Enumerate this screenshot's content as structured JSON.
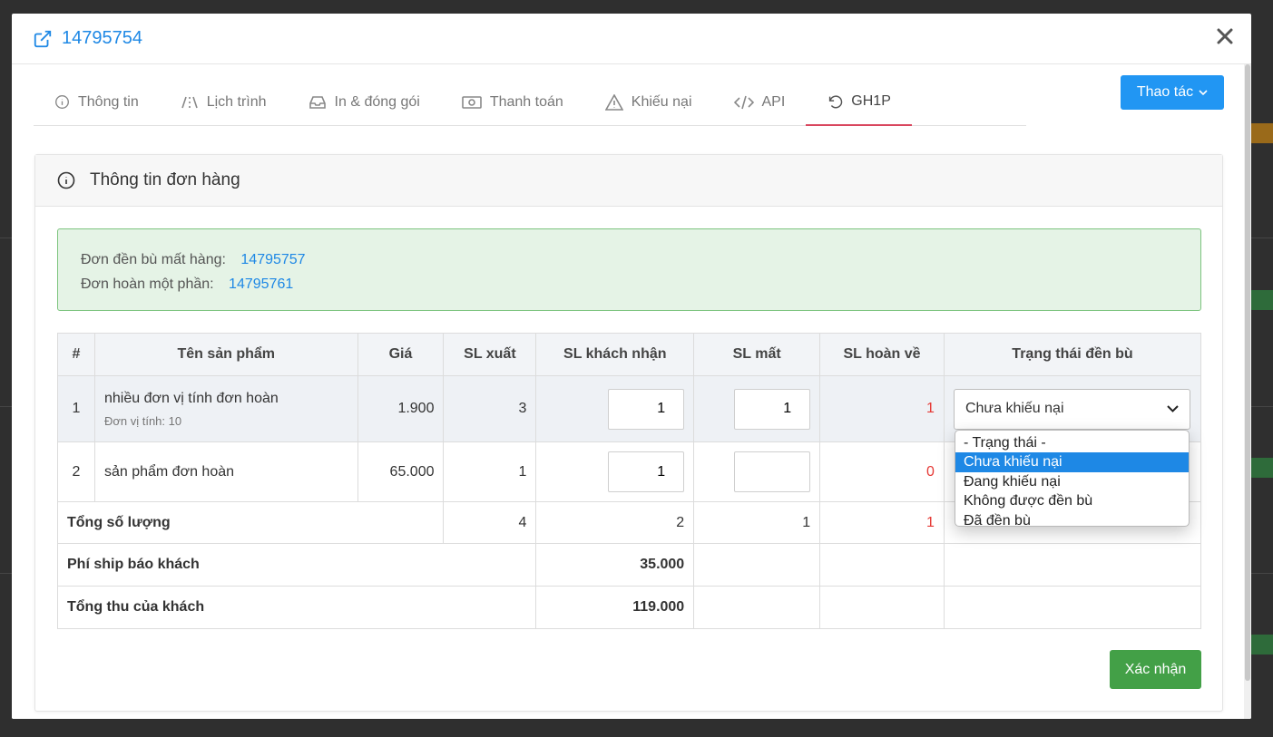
{
  "modal": {
    "title": "14795754",
    "close_label": "✕"
  },
  "tabs": [
    {
      "label": "Thông tin",
      "icon": "info-icon"
    },
    {
      "label": "Lịch trình",
      "icon": "road-icon"
    },
    {
      "label": "In & đóng gói",
      "icon": "inbox-icon"
    },
    {
      "label": "Thanh toán",
      "icon": "money-icon"
    },
    {
      "label": "Khiếu nại",
      "icon": "warning-icon"
    },
    {
      "label": "API",
      "icon": "code-icon"
    },
    {
      "label": "GH1P",
      "icon": "undo-icon",
      "active": true
    }
  ],
  "actions": {
    "label": "Thao tác"
  },
  "panel": {
    "title": "Thông tin đơn hàng",
    "alert": {
      "line1_label": "Đơn đền bù mất hàng:",
      "line1_value": "14795757",
      "line2_label": "Đơn hoàn một phần:",
      "line2_value": "14795761"
    },
    "table": {
      "headers": [
        "#",
        "Tên sản phẩm",
        "Giá",
        "SL xuất",
        "SL khách nhận",
        "SL mất",
        "SL hoàn về",
        "Trạng thái đền bù"
      ],
      "rows": [
        {
          "index": "1",
          "name": "nhiều đơn vị tính đơn hoàn",
          "unit": "Đơn vị tính: 10",
          "price": "1.900",
          "sl_xuat": "3",
          "sl_nhan": "1",
          "sl_mat": "1",
          "sl_hoan": "1",
          "status": "Chưa khiếu nại"
        },
        {
          "index": "2",
          "name": "sản phẩm đơn hoàn",
          "price": "65.000",
          "sl_xuat": "1",
          "sl_nhan": "1",
          "sl_mat": "",
          "sl_hoan": "0"
        }
      ],
      "total": {
        "label": "Tổng số lượng",
        "sl_xuat": "4",
        "sl_nhan": "2",
        "sl_mat": "1",
        "sl_hoan": "1"
      },
      "ship": {
        "label": "Phí ship báo khách",
        "value": "35.000"
      },
      "revenue": {
        "label": "Tổng thu của khách",
        "value": "119.000"
      }
    },
    "status_options": [
      "- Trạng thái -",
      "Chưa khiếu nại",
      "Đang khiếu nại",
      "Không được đền bù",
      "Đã đền bù"
    ],
    "selected_status_index": 1,
    "confirm_label": "Xác nhận"
  },
  "colors": {
    "primary": "#1e88e5",
    "success": "#43a047",
    "danger": "#e53935",
    "tab_active": "#d9465e"
  }
}
